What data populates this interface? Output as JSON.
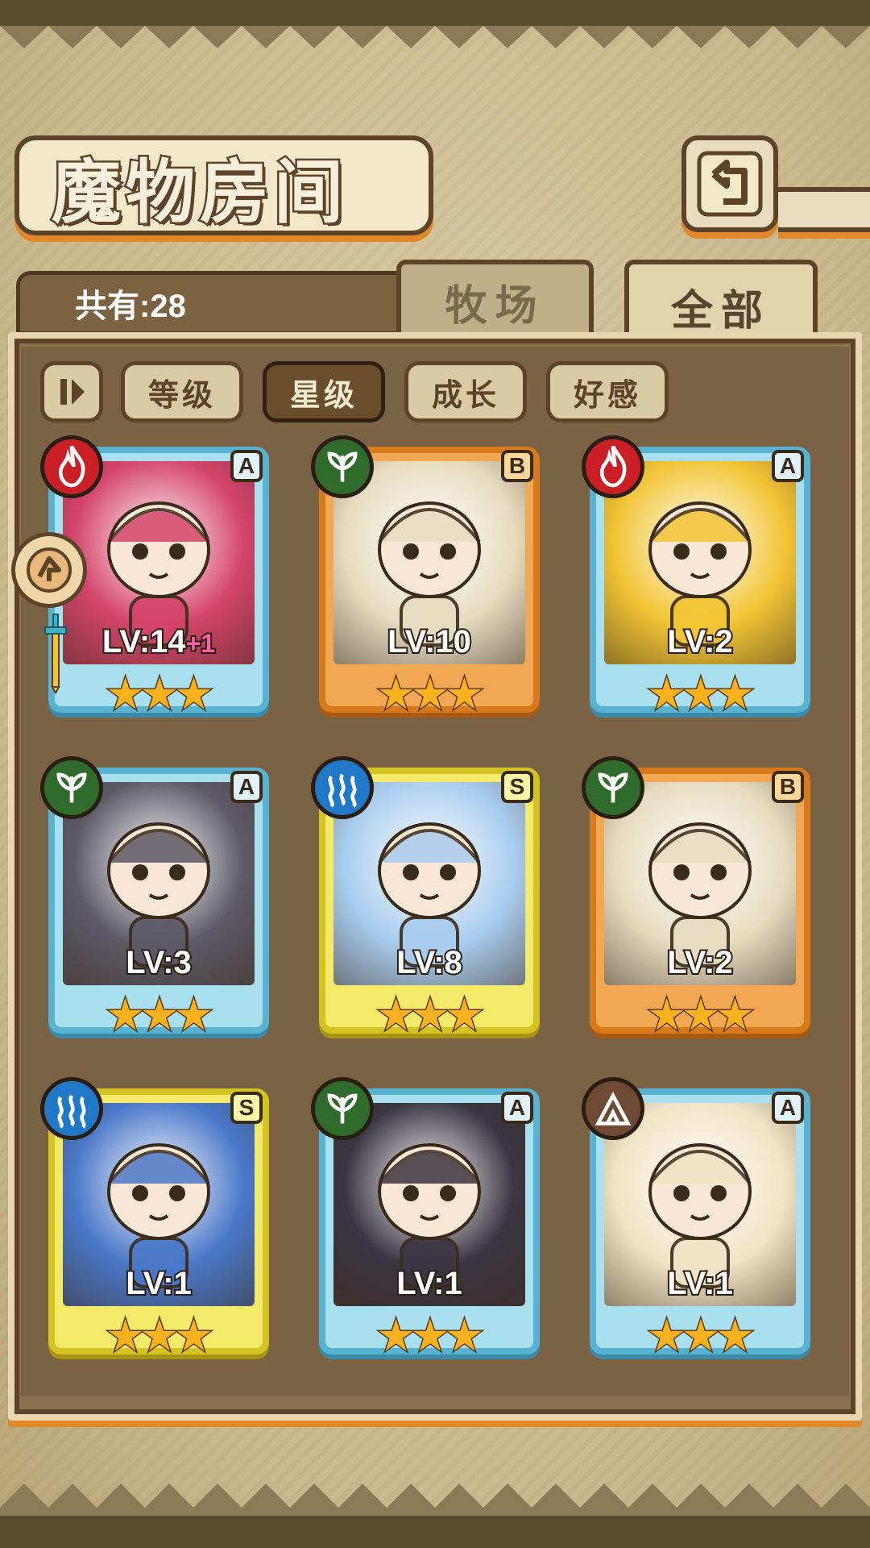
{
  "header": {
    "title": "魔物房间",
    "back_icon": "return-arrow-icon"
  },
  "summary": {
    "count_label": "共有:28"
  },
  "tabs": [
    {
      "label": "牧场",
      "active": false
    },
    {
      "label": "全部",
      "active": true
    }
  ],
  "sort": {
    "toggle_icon": "sort-order-icon",
    "buttons": [
      {
        "label": "等级",
        "active": false
      },
      {
        "label": "星级",
        "active": true
      },
      {
        "label": "成长",
        "active": false
      },
      {
        "label": "好感",
        "active": false
      }
    ]
  },
  "monsters": [
    {
      "rank": "A",
      "element": "fire-element-icon",
      "level": "LV:14",
      "bonus": "+1",
      "stars": "★★★",
      "portrait_color": "#d4446a"
    },
    {
      "rank": "B",
      "element": "leaf-element-icon",
      "level": "LV:10",
      "bonus": "",
      "stars": "★★★",
      "portrait_color": "#e6dcc0"
    },
    {
      "rank": "A",
      "element": "fire-element-icon",
      "level": "LV:2",
      "bonus": "",
      "stars": "★★★",
      "portrait_color": "#f2c535"
    },
    {
      "rank": "A",
      "element": "leaf-element-icon",
      "level": "LV:3",
      "bonus": "",
      "stars": "★★★",
      "portrait_color": "#5c5a66"
    },
    {
      "rank": "S",
      "element": "water-element-icon",
      "level": "LV:8",
      "bonus": "",
      "stars": "★★★",
      "portrait_color": "#a9cdef"
    },
    {
      "rank": "B",
      "element": "leaf-element-icon",
      "level": "LV:2",
      "bonus": "",
      "stars": "★★★",
      "portrait_color": "#e6dcc0"
    },
    {
      "rank": "S",
      "element": "water-element-icon",
      "level": "LV:1",
      "bonus": "",
      "stars": "★★★",
      "portrait_color": "#4a78c8"
    },
    {
      "rank": "A",
      "element": "leaf-element-icon",
      "level": "LV:1",
      "bonus": "",
      "stars": "★★★",
      "portrait_color": "#3a3540"
    },
    {
      "rank": "A",
      "element": "earth-element-icon",
      "level": "LV:1",
      "bonus": "",
      "stars": "★★★",
      "portrait_color": "#f1e3c4"
    }
  ],
  "indicators": {
    "first_card_badge": "leader-badge-icon",
    "first_card_weapon": "sword-icon"
  },
  "colors": {
    "frame_brown": "#5d4428",
    "accent_orange": "#e0882a",
    "rank_A": "#57b3d1",
    "rank_B": "#d67a1c",
    "rank_S": "#d4c322"
  }
}
